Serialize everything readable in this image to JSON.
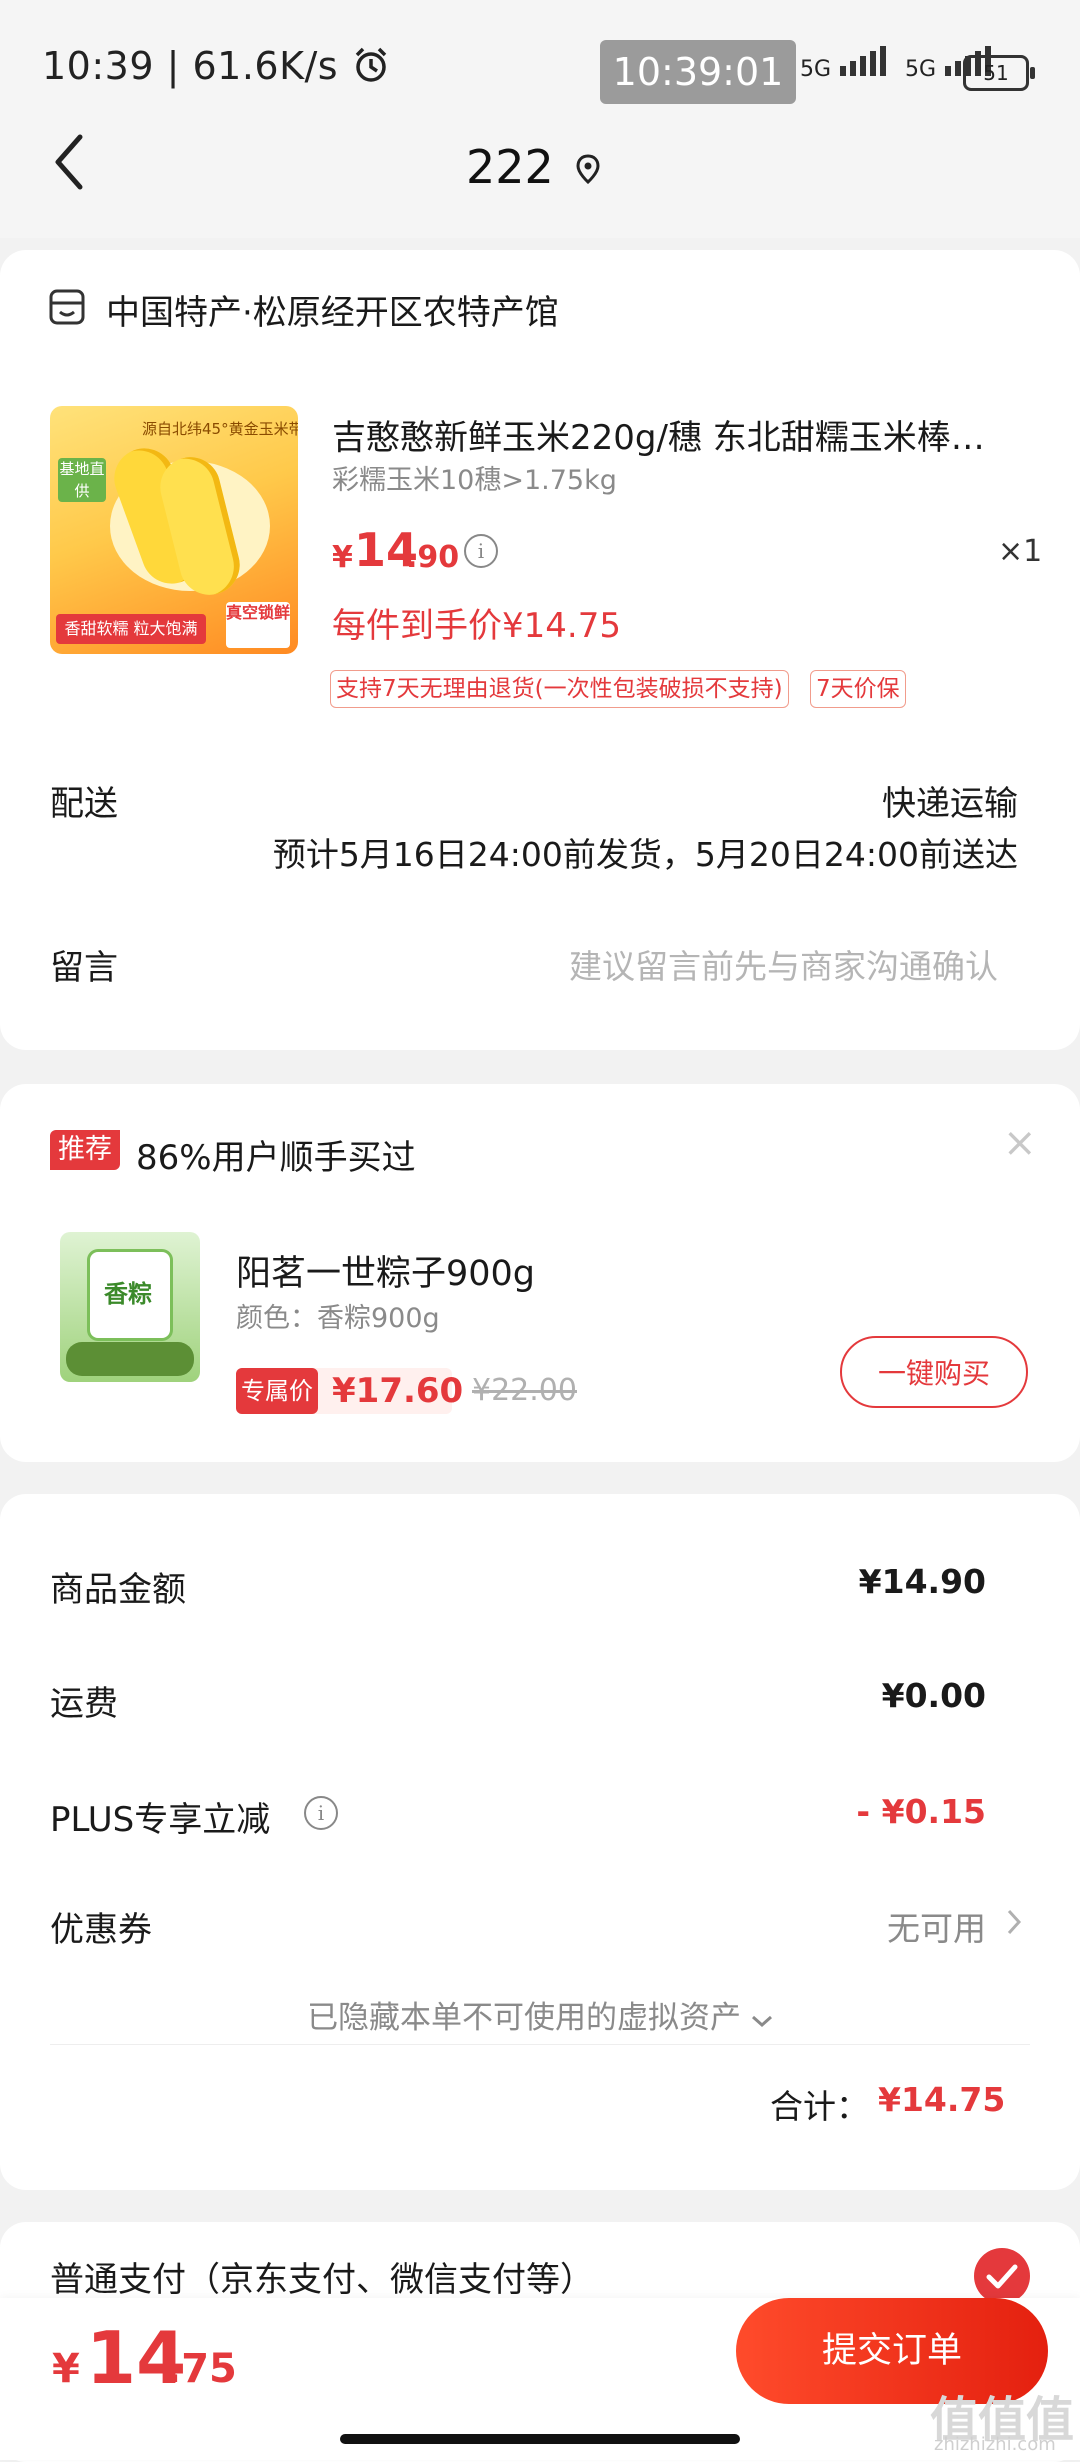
{
  "status_bar": {
    "left_text": "10:39 | 61.6K/s",
    "overlay_time": "10:39:01",
    "net1": "5G",
    "net2": "5G",
    "battery": "51"
  },
  "nav": {
    "title": "222"
  },
  "shop": {
    "name": "中国特产·松原经开区农特产馆"
  },
  "product": {
    "title": "吉憨憨新鲜玉米220g/穗  东北甜糯玉米棒…",
    "spec": "彩糯玉米10穗>1.75kg",
    "price_symbol": "¥",
    "price_int": "14",
    "price_dec": ".90",
    "quantity": "×1",
    "each_price": "每件到手价¥14.75",
    "tags": [
      "支持7天无理由退货(一次性包装破损不支持)",
      "7天价保"
    ],
    "image_texts": [
      "源自北纬45°黄金玉米带",
      "基地直供",
      "香甜软糯 粒大饱满",
      "真空锁鲜"
    ]
  },
  "delivery": {
    "label": "配送",
    "method": "快递运输",
    "eta": "预计5月16日24:00前发货，5月20日24:00前送达"
  },
  "message": {
    "label": "留言",
    "placeholder": "建议留言前先与商家沟通确认"
  },
  "recommend": {
    "badge": "推荐",
    "title": "86%用户顺手买过",
    "item_name": "阳茗一世粽子900g",
    "item_spec": "颜色：香粽900g",
    "exclusive_label": "专属价",
    "price": "¥17.60",
    "original_price": "¥22.00",
    "buy_label": "一键购买",
    "image_text": "香粽"
  },
  "summary": {
    "goods_label": "商品金额",
    "goods_value": "¥14.90",
    "shipping_label": "运费",
    "shipping_value": "¥0.00",
    "plus_label": "PLUS专享立减",
    "plus_value": "- ¥0.15",
    "coupon_label": "优惠券",
    "coupon_value": "无可用",
    "hidden_note": "已隐藏本单不可使用的虚拟资产",
    "total_label": "合计：",
    "total_value": "¥14.75"
  },
  "payment": {
    "title": "普通支付（京东支付、微信支付等）"
  },
  "bottom": {
    "price_symbol": "¥",
    "price_int": "14",
    "price_dec": ".75",
    "submit_label": "提交订单",
    "watermark": "值值值",
    "watermark_url": "zhizhizhi.com"
  },
  "colors": {
    "accent": "#e4393c",
    "background": "#f2f2f2"
  }
}
